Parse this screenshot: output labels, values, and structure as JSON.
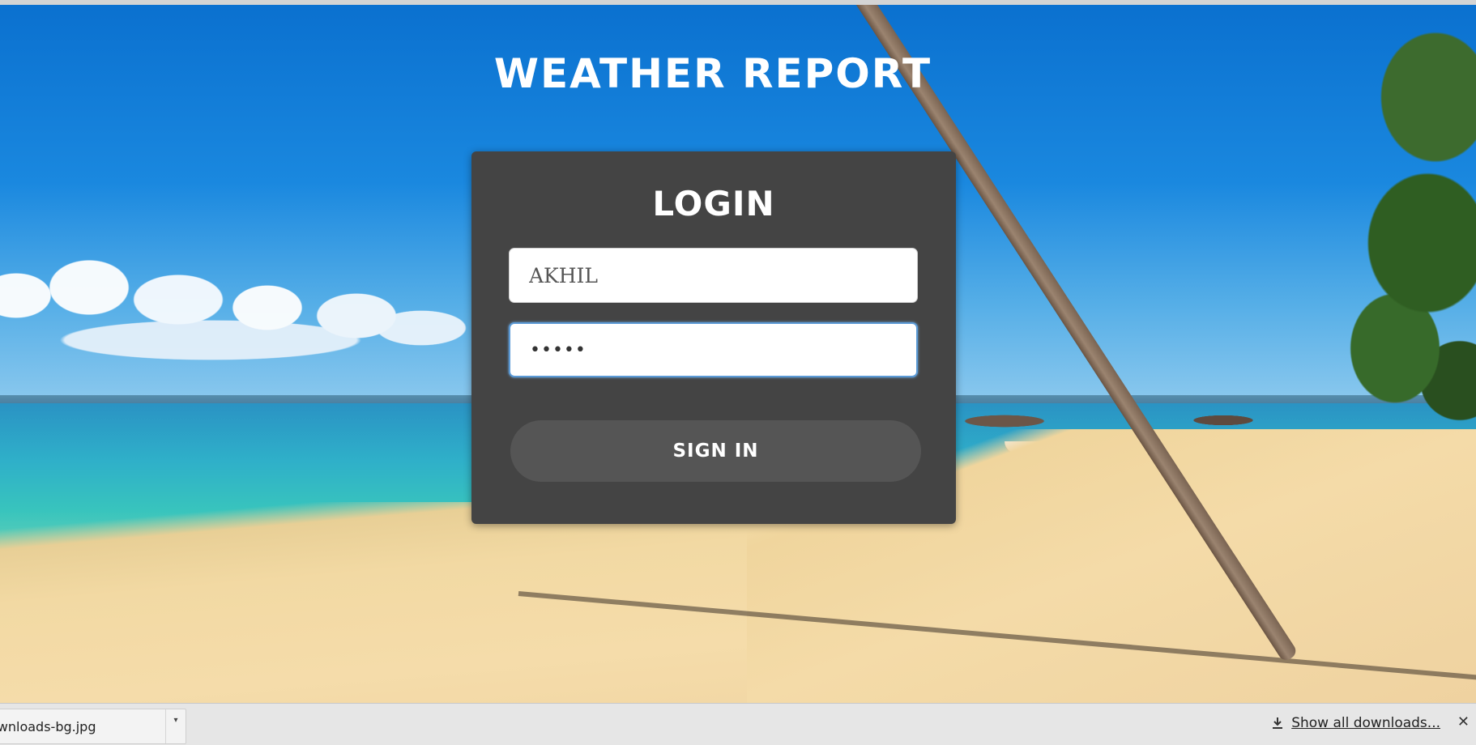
{
  "page": {
    "title": "WEATHER REPORT"
  },
  "login": {
    "heading": "LOGIN",
    "username_value": "AKHIL",
    "password_value": "•••••",
    "submit_label": "SIGN IN"
  },
  "downloads": {
    "file_name": "ownloads-bg.jpg",
    "arrow": "▾",
    "show_all_label": "Show all downloads...",
    "close_glyph": "✕"
  },
  "colors": {
    "card_bg": "#444444",
    "button_bg": "#555555",
    "focus_border": "#5b9ad6"
  }
}
